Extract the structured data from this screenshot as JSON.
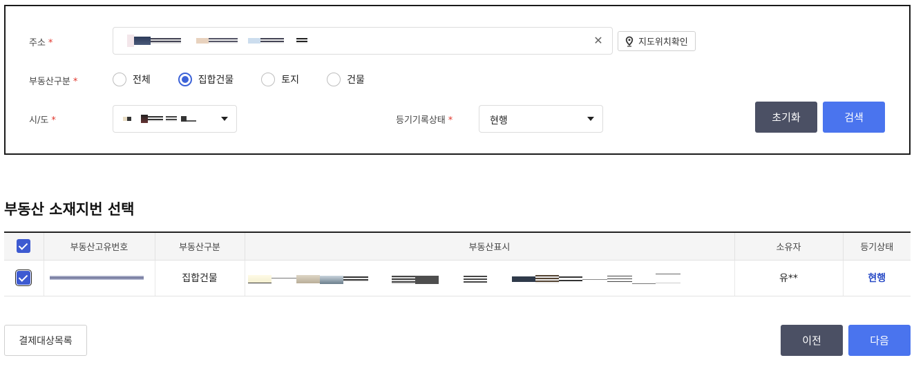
{
  "search": {
    "address": {
      "label": "주소",
      "required_mark": "*",
      "clear_icon": "close-icon",
      "map_button_label": "지도위치확인",
      "map_icon": "location-pin-icon"
    },
    "property_type": {
      "label": "부동산구분",
      "required_mark": "*",
      "options": [
        "전체",
        "집합건물",
        "토지",
        "건물"
      ],
      "selected": "집합건물"
    },
    "region": {
      "label": "시/도",
      "required_mark": "*"
    },
    "registry_status": {
      "label": "등기기록상태",
      "required_mark": "*",
      "value": "현행"
    },
    "reset_label": "초기화",
    "search_label": "검색"
  },
  "results": {
    "title": "부동산 소재지번 선택",
    "columns": [
      "부동산고유번호",
      "부동산구분",
      "부동산표시",
      "소유자",
      "등기상태"
    ],
    "rows": [
      {
        "checked": true,
        "type": "집합건물",
        "owner": "유**",
        "status": "현행"
      }
    ],
    "header_checked": true
  },
  "footer": {
    "payment_list_label": "결제대상목록",
    "prev_label": "이전",
    "next_label": "다음"
  },
  "colors": {
    "primary": "#4a74ee",
    "dark_button": "#4b5064",
    "required": "#e0352b",
    "status_link": "#2b4dc7"
  }
}
